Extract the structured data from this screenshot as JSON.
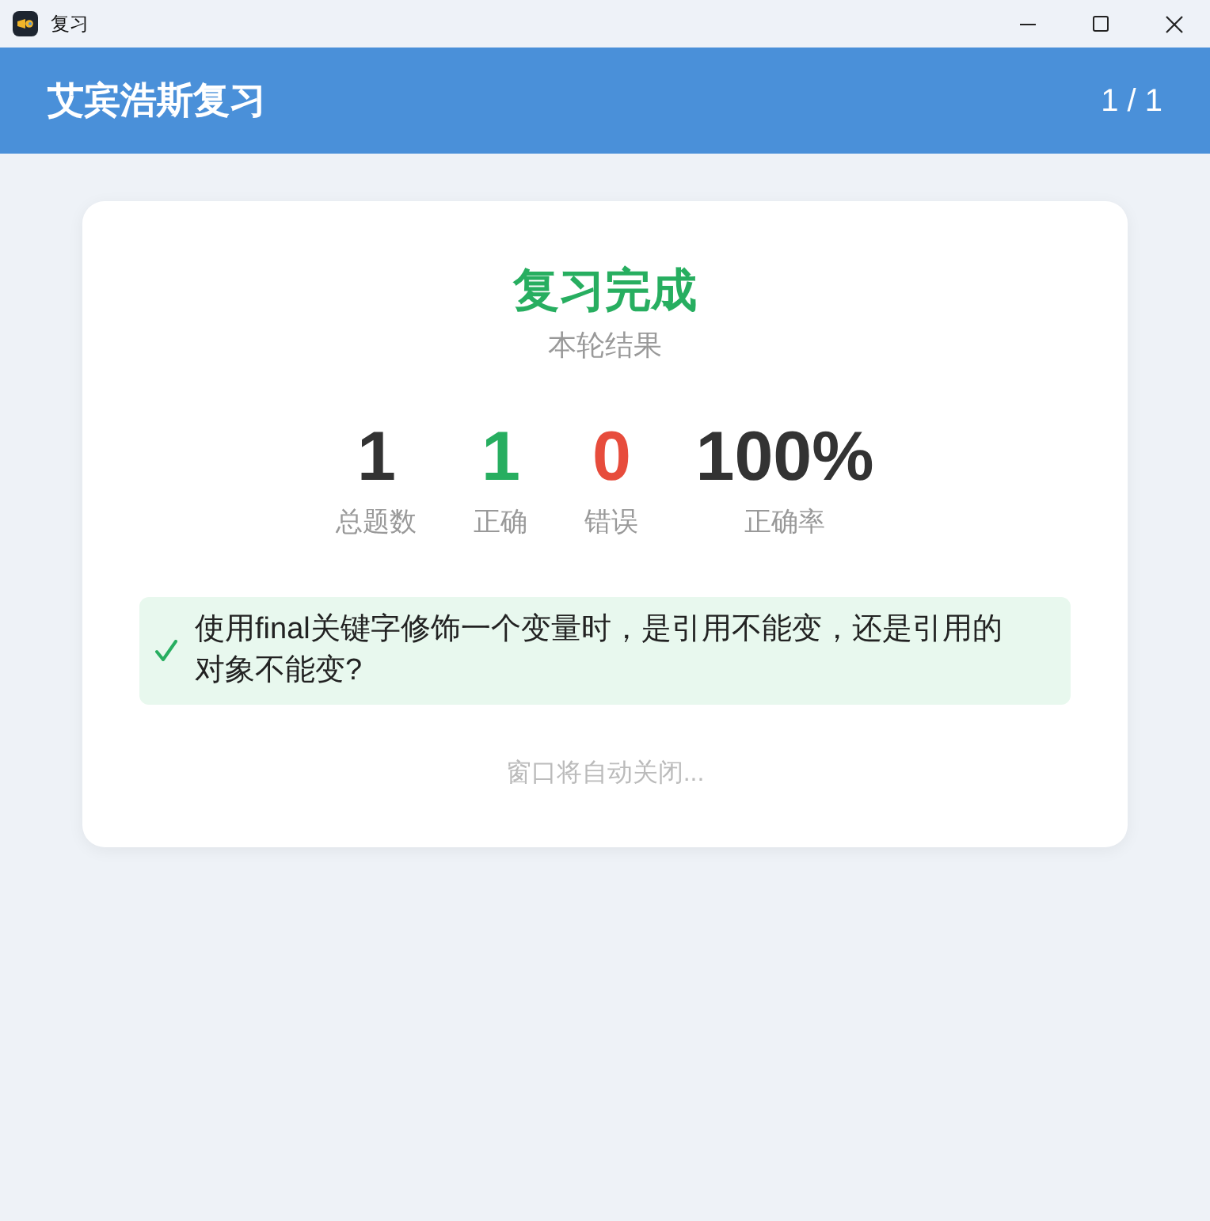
{
  "window": {
    "title": "复习"
  },
  "header": {
    "title": "艾宾浩斯复习",
    "progress": "1 / 1"
  },
  "summary": {
    "title": "复习完成",
    "subtitle": "本轮结果",
    "stats": [
      {
        "value": "1",
        "label": "总题数",
        "color": "#333333"
      },
      {
        "value": "1",
        "label": "正确",
        "color": "#27ae60"
      },
      {
        "value": "0",
        "label": "错误",
        "color": "#e74c3c"
      },
      {
        "value": "100%",
        "label": "正确率",
        "color": "#333333"
      }
    ]
  },
  "results": [
    {
      "question": "使用final关键字修饰一个变量时，是引用不能变，还是引用的对象不能变?",
      "correct": true
    }
  ],
  "footer_note": "窗口将自动关闭..."
}
